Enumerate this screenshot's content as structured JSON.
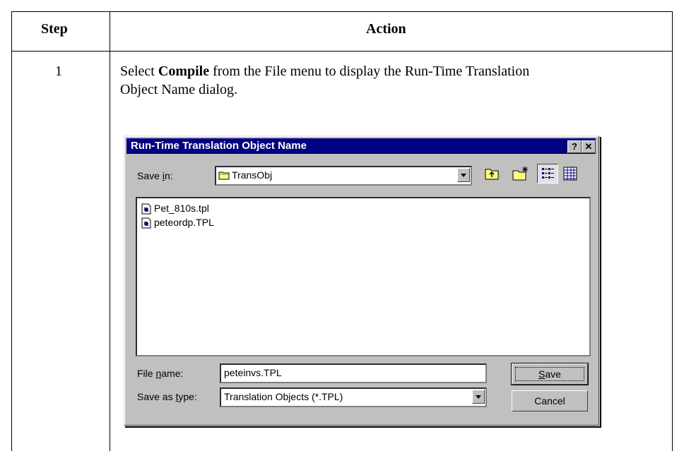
{
  "table": {
    "col_step": "Step",
    "col_action": "Action",
    "step_number": "1",
    "instruction_pre": "Select ",
    "instruction_bold": "Compile",
    "instruction_post": " from the File menu to display the Run-Time Translation Object Name dialog."
  },
  "dialog": {
    "title": "Run-Time Translation Object Name",
    "help_btn": "?",
    "close_btn": "✕",
    "save_in_label": "Save in:",
    "save_in_value": "TransObj",
    "files": [
      "Pet_810s.tpl",
      "peteordp.TPL"
    ],
    "filename_label": "File name:",
    "filename_value": "peteinvs.TPL",
    "type_label": "Save as type:",
    "type_value": "Translation Objects (*.TPL)",
    "save_button": "Save",
    "cancel_button": "Cancel"
  }
}
